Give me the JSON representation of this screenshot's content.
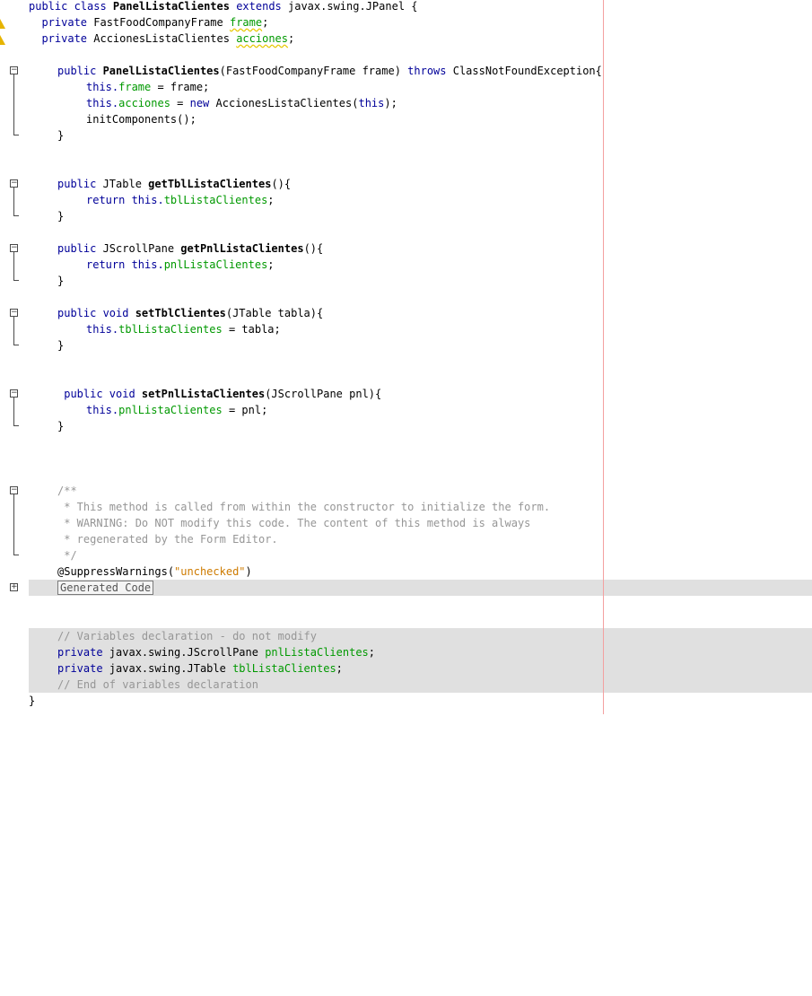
{
  "editor": {
    "lines": {
      "l0": {
        "a": "public class ",
        "b": "PanelListaClientes",
        "c": " extends ",
        "d": "javax.swing.JPanel {"
      },
      "l1": {
        "a": "  private ",
        "b": "FastFoodCompanyFrame ",
        "c": "frame",
        ";": ";"
      },
      "l2": {
        "a": "  private ",
        "b": "AccionesListaClientes ",
        "c": "acciones",
        ";": ";"
      },
      "l4": {
        "a": "public ",
        "b": "PanelListaClientes",
        "c": "(FastFoodCompanyFrame frame) ",
        "d": "throws ",
        "e": "ClassNotFoundException{"
      },
      "l5": {
        "a": "this.",
        "b": "frame",
        "c": " = frame;"
      },
      "l6": {
        "a": "this.",
        "b": "acciones",
        "c": " = ",
        "d": "new ",
        "e": "AccionesListaClientes(",
        "f": "this",
        "g": ");"
      },
      "l7": {
        "a": "initComponents();"
      },
      "l8": {
        "a": "}"
      },
      "l11": {
        "a": "public ",
        "b": "JTable ",
        "c": "getTblListaClientes",
        "d": "(){"
      },
      "l12": {
        "a": "return ",
        "b": "this.",
        "c": "tblListaClientes",
        ";": ";"
      },
      "l13": {
        "a": "}"
      },
      "l15": {
        "a": "public ",
        "b": "JScrollPane ",
        "c": "getPnlListaClientes",
        "d": "(){"
      },
      "l16": {
        "a": "return ",
        "b": "this.",
        "c": "pnlListaClientes",
        ";": ";"
      },
      "l17": {
        "a": "}"
      },
      "l19": {
        "a": "public ",
        "b": "void ",
        "c": "setTblClientes",
        "d": "(JTable tabla){"
      },
      "l20": {
        "a": "this.",
        "b": "tblListaClientes",
        "c": " = tabla;"
      },
      "l21": {
        "a": "}"
      },
      "l24": {
        "a": " public ",
        "b": "void ",
        "c": "setPnlListaClientes",
        "d": "(JScrollPane pnl){"
      },
      "l25": {
        "a": "this.",
        "b": "pnlListaClientes",
        "c": " = pnl;"
      },
      "l26": {
        "a": "}"
      },
      "l30": {
        "a": "/**"
      },
      "l31": {
        "a": " * This method is called from within the constructor to initialize the form."
      },
      "l32": {
        "a": " * WARNING: Do NOT modify this code. The content of this method is always"
      },
      "l33": {
        "a": " * regenerated by the Form Editor."
      },
      "l34": {
        "a": " */"
      },
      "l35": {
        "a": "@SuppressWarnings(",
        "b": "\"unchecked\"",
        "c": ")"
      },
      "l36": {
        "a": "Generated Code"
      },
      "l39": {
        "a": "// Variables declaration - do not modify"
      },
      "l40": {
        "a": "private ",
        "b": "javax.swing.JScrollPane ",
        "c": "pnlListaClientes",
        ";": ";"
      },
      "l41": {
        "a": "private ",
        "b": "javax.swing.JTable ",
        "c": "tblListaClientes",
        ";": ";"
      },
      "l42": {
        "a": "// End of variables declaration"
      },
      "l43": {
        "a": "}"
      }
    },
    "fold_collapse_symbol": "−",
    "fold_expand_symbol": "+",
    "warning_symbol": "!"
  },
  "colors": {
    "keyword": "#000099",
    "field": "#009900",
    "comment": "#969696",
    "string": "#ce7b00",
    "guarded_background": "#e0e0e0",
    "margin_line": "#f4a0a0"
  }
}
